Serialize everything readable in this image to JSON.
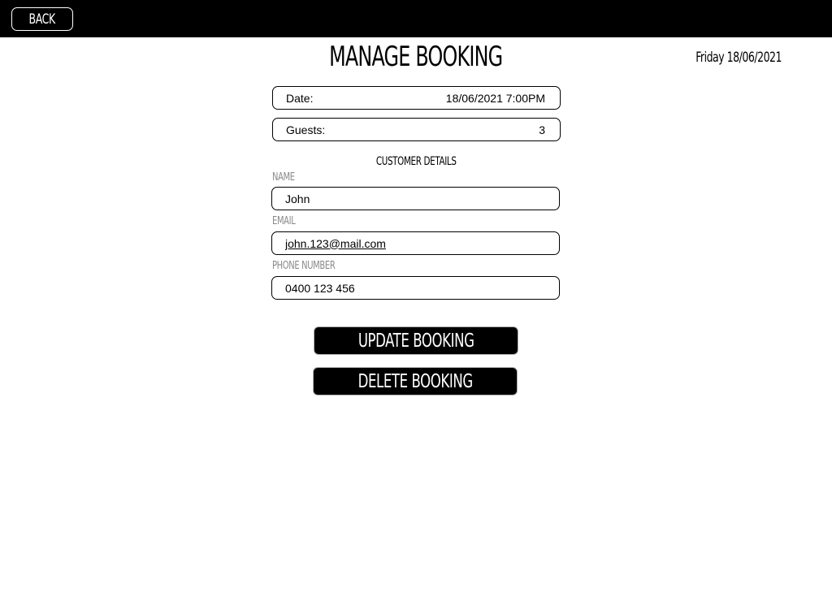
{
  "header": {
    "back_label": "BACK"
  },
  "page": {
    "title": "MANAGE BOOKING",
    "current_date": "Friday 18/06/2021"
  },
  "booking": {
    "date_label": "Date:",
    "date_value": "18/06/2021 7:00PM",
    "guests_label": "Guests:",
    "guests_value": "3"
  },
  "customer": {
    "section_title": "CUSTOMER DETAILS",
    "name_label": "NAME",
    "name_value": "John",
    "email_label": "EMAIL",
    "email_value": "john.123@mail.com",
    "phone_label": "PHONE NUMBER",
    "phone_value": "0400 123 456"
  },
  "actions": {
    "update_label": "UPDATE BOOKING",
    "delete_label": "DELETE BOOKING"
  },
  "colors": {
    "topbar": "#000000",
    "button_bg": "#000000",
    "label_gray": "#8a8a8a"
  }
}
